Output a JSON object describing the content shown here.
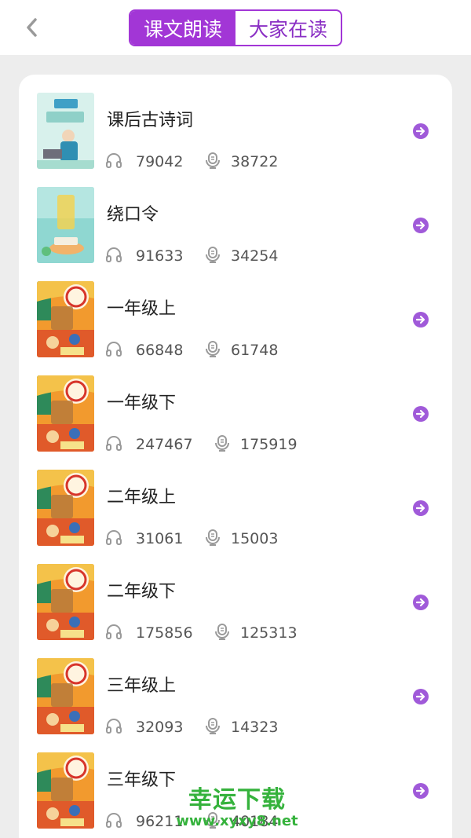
{
  "header": {
    "tabs": [
      {
        "label": "课文朗读",
        "active": true
      },
      {
        "label": "大家在读",
        "active": false
      }
    ]
  },
  "colors": {
    "accent": "#a236d6",
    "background": "#ededed"
  },
  "icons": {
    "back": "chevron-left-icon",
    "listens": "headphones-icon",
    "recordings": "microphone-icon",
    "open": "arrow-right-circle-icon"
  },
  "books": [
    {
      "title": "课后古诗词",
      "listens": "79042",
      "recordings": "38722",
      "cover": "green-poetry"
    },
    {
      "title": "绕口令",
      "listens": "91633",
      "recordings": "34254",
      "cover": "teal-tongue-twister"
    },
    {
      "title": "一年级上",
      "listens": "66848",
      "recordings": "61748",
      "cover": "orange-textbook"
    },
    {
      "title": "一年级下",
      "listens": "247467",
      "recordings": "175919",
      "cover": "orange-textbook"
    },
    {
      "title": "二年级上",
      "listens": "31061",
      "recordings": "15003",
      "cover": "orange-textbook"
    },
    {
      "title": "二年级下",
      "listens": "175856",
      "recordings": "125313",
      "cover": "orange-textbook"
    },
    {
      "title": "三年级上",
      "listens": "32093",
      "recordings": "14323",
      "cover": "orange-textbook"
    },
    {
      "title": "三年级下",
      "listens": "96211",
      "recordings": "40184",
      "cover": "orange-textbook"
    }
  ],
  "watermark": {
    "line1": "幸运下载",
    "line2": "www.xyxy8.net"
  }
}
